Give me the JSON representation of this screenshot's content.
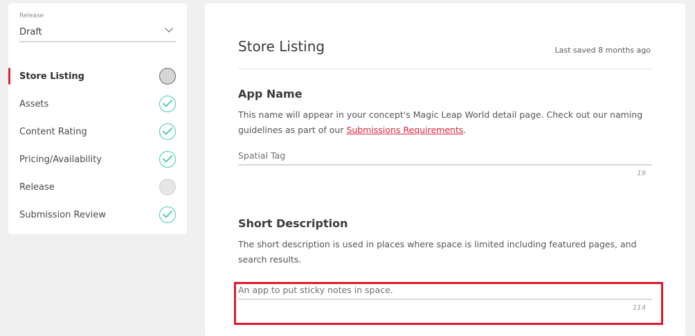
{
  "sidebar": {
    "release_caption": "Release",
    "release_value": "Draft",
    "items": [
      {
        "label": "Store Listing",
        "status": "current"
      },
      {
        "label": "Assets",
        "status": "done"
      },
      {
        "label": "Content Rating",
        "status": "done"
      },
      {
        "label": "Pricing/Availability",
        "status": "done"
      },
      {
        "label": "Release",
        "status": "empty"
      },
      {
        "label": "Submission Review",
        "status": "done"
      }
    ]
  },
  "main": {
    "title": "Store Listing",
    "last_saved": "Last saved 8 months ago",
    "app_name": {
      "title": "App Name",
      "desc_before": "This name will appear in your concept's Magic Leap World detail page. Check out our naming guidelines as part of our ",
      "link": "Submissions Requirements",
      "desc_after": ".",
      "value": "Spatial Tag",
      "count": "19"
    },
    "short_description": {
      "title": "Short Description",
      "desc": "The short description is used in places where space is limited including featured pages, and search results.",
      "value": "An app to put sticky notes in space.",
      "count": "114"
    }
  },
  "colors": {
    "accent": "#e0233a",
    "done": "#3fcf95",
    "highlight": "#e0182d"
  }
}
